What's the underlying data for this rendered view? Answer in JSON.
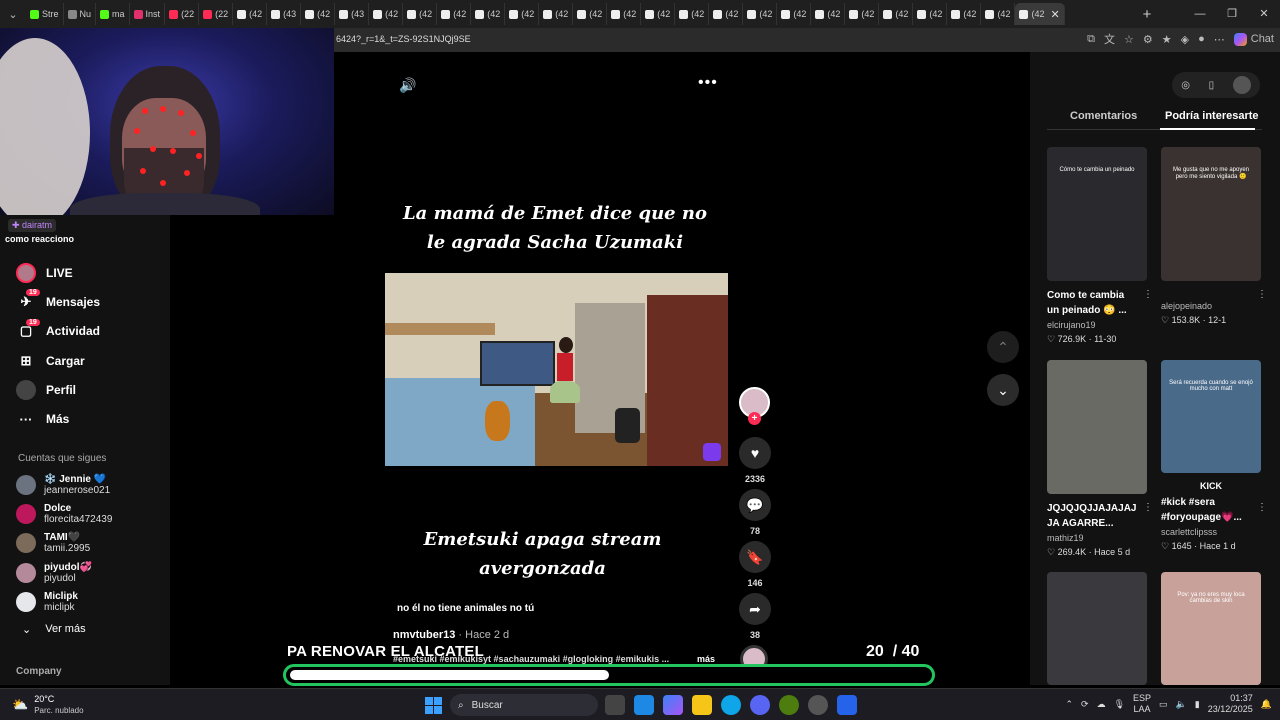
{
  "browser": {
    "tabs": [
      {
        "label": "Stre",
        "color": "#53fc18"
      },
      {
        "label": "Nu",
        "color": "#888888"
      },
      {
        "label": "ma",
        "color": "#53fc18"
      },
      {
        "label": "Inst",
        "color": "#e1306c"
      },
      {
        "label": "(22",
        "color": "#fe2c55"
      },
      {
        "label": "(22",
        "color": "#fe2c55"
      },
      {
        "label": "(42",
        "color": "#eeeeee"
      },
      {
        "label": "(43",
        "color": "#eeeeee"
      },
      {
        "label": "(42",
        "color": "#eeeeee"
      },
      {
        "label": "(43",
        "color": "#eeeeee"
      },
      {
        "label": "(42",
        "color": "#eeeeee"
      },
      {
        "label": "(42",
        "color": "#eeeeee"
      },
      {
        "label": "(42",
        "color": "#eeeeee"
      },
      {
        "label": "(42",
        "color": "#eeeeee"
      },
      {
        "label": "(42",
        "color": "#eeeeee"
      },
      {
        "label": "(42",
        "color": "#eeeeee"
      },
      {
        "label": "(42",
        "color": "#eeeeee"
      },
      {
        "label": "(42",
        "color": "#eeeeee"
      },
      {
        "label": "(42",
        "color": "#eeeeee"
      },
      {
        "label": "(42",
        "color": "#eeeeee"
      },
      {
        "label": "(42",
        "color": "#eeeeee"
      },
      {
        "label": "(42",
        "color": "#eeeeee"
      },
      {
        "label": "(42",
        "color": "#eeeeee"
      },
      {
        "label": "(42",
        "color": "#eeeeee"
      },
      {
        "label": "(42",
        "color": "#eeeeee"
      },
      {
        "label": "(42",
        "color": "#eeeeee"
      },
      {
        "label": "(42",
        "color": "#eeeeee"
      },
      {
        "label": "(42",
        "color": "#eeeeee"
      },
      {
        "label": "(42",
        "color": "#eeeeee"
      },
      {
        "label": "(42",
        "color": "#eeeeee"
      }
    ],
    "url": "6424?_r=1&_t=ZS-92S1NJQj9SE",
    "chat_label": "Chat"
  },
  "overlay_user": {
    "badge": "dairatm",
    "caption": "como reacciono"
  },
  "sidebar": {
    "menu": [
      {
        "label": "LIVE",
        "icon": "live-avatar-icon",
        "badge": ""
      },
      {
        "label": "Mensajes",
        "icon": "send-icon",
        "badge": "19"
      },
      {
        "label": "Actividad",
        "icon": "inbox-icon",
        "badge": "19"
      },
      {
        "label": "Cargar",
        "icon": "plus-square-icon",
        "badge": ""
      },
      {
        "label": "Perfil",
        "icon": "profile-avatar-icon",
        "badge": ""
      },
      {
        "label": "Más",
        "icon": "more-dots-icon",
        "badge": ""
      }
    ],
    "following_title": "Cuentas que sigues",
    "following": [
      {
        "name": "❄️ Jennie 💙",
        "handle": "jeannerose021",
        "color": "#6b7280"
      },
      {
        "name": "Dolce",
        "handle": "florecita472439",
        "color": "#be185d"
      },
      {
        "name": "TAMI🖤",
        "handle": "tamii.2995",
        "color": "#7c6a5a"
      },
      {
        "name": "piyudol💞",
        "handle": "piyudol",
        "color": "#b48a9a"
      },
      {
        "name": "Miclipk",
        "handle": "miclipk",
        "color": "#e5e7eb"
      }
    ],
    "see_more": "Ver más",
    "company": "Company"
  },
  "video": {
    "title_top": "La mamá de Emet dice que no le agrada Sacha Uzumaki",
    "title_bottom": "Emetsuki apaga stream avergonzada",
    "subtitle": "no él no tiene animales no tú",
    "author": "nmvtuber13",
    "ago": " · Hace 2 d",
    "tags": "#emetsuki #emikukisyt  #sachauzumaki #glogloking #emikukis ...",
    "more": "más",
    "likes": "2336",
    "comments": "78",
    "saves": "146",
    "shares": "38"
  },
  "right_panel": {
    "tab_comments": "Comentarios",
    "tab_suggested": "Podría interesarte",
    "cards": [
      {
        "title": "Como te cambia un peinado 😳 ...",
        "user": "elcirujano19",
        "stats": "♡ 726.9K · 11-30",
        "caption": "Cómo te cambia un peinado",
        "bg": "#2a2a2e"
      },
      {
        "title": "",
        "user": "alejopeinado",
        "stats": "♡ 153.8K · 12-1",
        "caption": "Me gusta que no me apoyen pero me siento vigilada 🙂",
        "bg": "#3a3230"
      },
      {
        "title": "JQJQJQJJAJAJAJ JA AGARRE...",
        "user": "mathiz19",
        "stats": "♡ 269.4K · Hace 5 d",
        "caption": "",
        "bg": "#6a6a64"
      },
      {
        "title": "#kick #sera #foryoupage💗...",
        "user": "scarlettclipsss",
        "stats": "♡ 1645 · Hace 1 d",
        "caption": "Será recuerda cuando se enojó mucho con matt",
        "bg": "#4a6a8a"
      },
      {
        "title": "",
        "user": "",
        "stats": "",
        "caption": "",
        "bg": "#3a3a3e"
      },
      {
        "title": "",
        "user": "",
        "stats": "",
        "caption": "Pov: ya no eres muy loca cambias de skin",
        "bg": "#c8a29a"
      }
    ],
    "kick_label": "KICK"
  },
  "stream_overlay": {
    "text": "PA RENOVAR EL ALCATEL",
    "current": "20",
    "total": "/ 40",
    "progress_fraction": 0.5
  },
  "taskbar": {
    "temp": "20°C",
    "weather": "Parc. nublado",
    "search_placeholder": "Buscar",
    "lang1": "ESP",
    "lang2": "LAA",
    "time": "01:37",
    "date": "23/12/2025"
  },
  "colors": {
    "accent": "#fe2c55",
    "overlay_green": "#22c55e"
  }
}
